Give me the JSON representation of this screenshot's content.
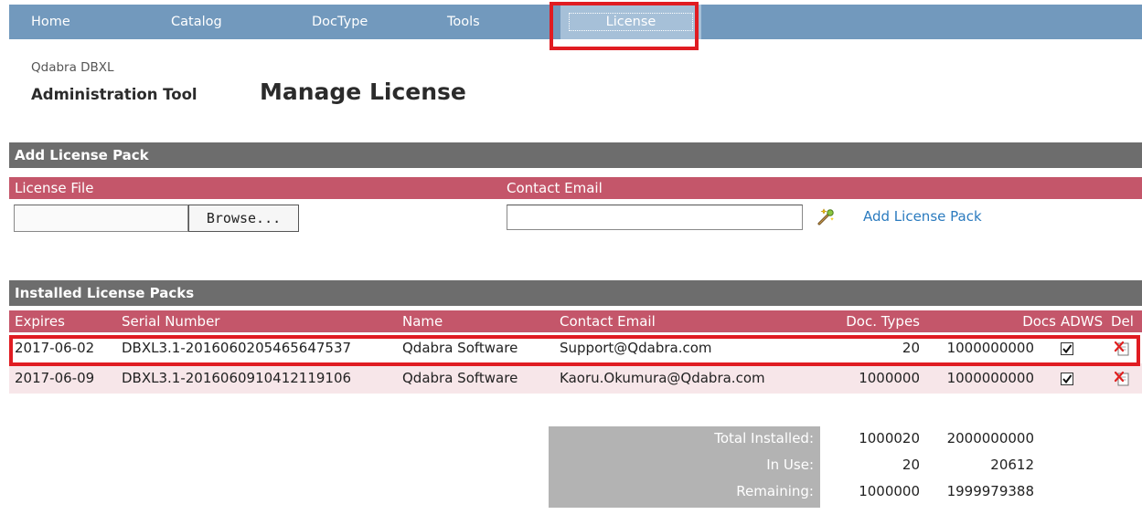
{
  "nav": {
    "items": [
      {
        "label": "Home"
      },
      {
        "label": "Catalog"
      },
      {
        "label": "DocType"
      },
      {
        "label": "Tools"
      },
      {
        "label": "License"
      }
    ],
    "active": "License"
  },
  "header": {
    "product": "Qdabra DBXL",
    "app_title": "Administration Tool",
    "page_title": "Manage License"
  },
  "add_pack": {
    "section_title": "Add License Pack",
    "col_license_file": "License File",
    "col_contact_email": "Contact Email",
    "browse_label": "Browse...",
    "file_value": "",
    "email_value": "",
    "add_link": "Add License Pack"
  },
  "installed": {
    "section_title": "Installed License Packs",
    "columns": {
      "expires": "Expires",
      "serial": "Serial Number",
      "name": "Name",
      "email": "Contact Email",
      "doc_types": "Doc. Types",
      "docs": "Docs",
      "adws": "ADWS",
      "del": "Del"
    },
    "rows": [
      {
        "expires": "2017-06-02",
        "serial": "DBXL3.1-2016060205465647537",
        "name": "Qdabra Software",
        "email": "Support@Qdabra.com",
        "doc_types": "20",
        "docs": "1000000000",
        "adws": true
      },
      {
        "expires": "2017-06-09",
        "serial": "DBXL3.1-2016060910412119106",
        "name": "Qdabra Software",
        "email": "Kaoru.Okumura@Qdabra.com",
        "doc_types": "1000000",
        "docs": "1000000000",
        "adws": true
      }
    ]
  },
  "totals": {
    "installed_label": "Total Installed:",
    "in_use_label": "In Use:",
    "remaining_label": "Remaining:",
    "installed": {
      "doc_types": "1000020",
      "docs": "2000000000"
    },
    "in_use": {
      "doc_types": "20",
      "docs": "20612"
    },
    "remaining": {
      "doc_types": "1000000",
      "docs": "1999979388"
    }
  },
  "colors": {
    "nav_bg": "#7299bd",
    "section_bg": "#6d6d6d",
    "header_bg": "#c4566a",
    "highlight": "#e01c22",
    "link": "#2b7bbf",
    "row_alt": "#f7e6e9"
  }
}
